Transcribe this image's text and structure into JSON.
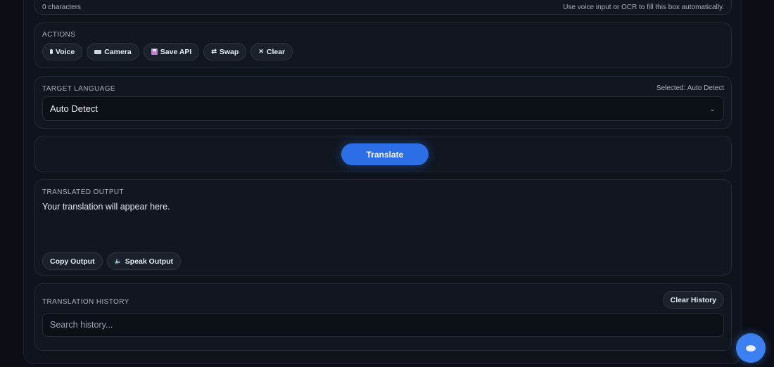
{
  "top": {
    "char_count": "0 characters",
    "hint": "Use voice input or OCR to fill this box automatically."
  },
  "actions": {
    "label": "ACTIONS",
    "buttons": [
      {
        "label": "Voice",
        "icon": "mic-icon"
      },
      {
        "label": "Camera",
        "icon": "camera-icon"
      },
      {
        "label": "Save API",
        "icon": "floppy-disk-icon"
      },
      {
        "label": "Swap",
        "icon": "swap-arrows-icon",
        "glyph": "⇄"
      },
      {
        "label": "Clear",
        "icon": "close-icon",
        "glyph": "✕"
      }
    ]
  },
  "target_language": {
    "label": "TARGET LANGUAGE",
    "selected_text": "Selected: Auto Detect",
    "value": "Auto Detect",
    "chevron": "⌄"
  },
  "translate": {
    "label": "Translate",
    "color": "#2b6ee6"
  },
  "output": {
    "label": "TRANSLATED OUTPUT",
    "placeholder_text": "Your translation will appear here.",
    "buttons": [
      {
        "label": "Copy Output"
      },
      {
        "label": "Speak Output",
        "icon": "speaker-icon",
        "glyph": "🔈"
      }
    ]
  },
  "history": {
    "label": "TRANSLATION HISTORY",
    "clear_label": "Clear History",
    "search_placeholder": "Search history..."
  },
  "fab": {
    "icon": "chat-bubble-icon",
    "color": "#3b7ff0"
  }
}
